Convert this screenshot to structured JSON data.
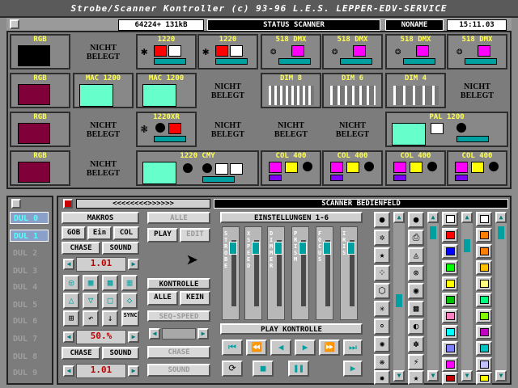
{
  "title": "Strobe/Scanner Kontroller (c) 93-96 L.E.S. LEPPER-EDV-SERVICE",
  "status": {
    "memory": "64224+ 131kB",
    "header": "STATUS SCANNER",
    "file": "NONAME",
    "time": "15:11.03"
  },
  "grid": {
    "row1": [
      "RGB",
      "NICHT BELEGT",
      "1220",
      "1220",
      "518 DMX",
      "518 DMX",
      "518 DMX",
      "518 DMX"
    ],
    "row2": [
      "RGB",
      "MAC 1200",
      "MAC 1200",
      "NICHT BELEGT",
      "DIM 8",
      "DIM 6",
      "DIM 4",
      "NICHT BELEGT"
    ],
    "row3": [
      "RGB",
      "NICHT BELEGT",
      "1220XR",
      "NICHT BELEGT",
      "NICHT BELEGT",
      "NICHT BELEGT",
      "PAL 1200",
      ""
    ],
    "row4": [
      "RGB",
      "NICHT BELEGT",
      "1220 CMY",
      "COL 400",
      "COL 400",
      "COL 400",
      "COL 400"
    ]
  },
  "dul": [
    "DUL 0",
    "DUL 1",
    "DUL 2",
    "DUL 3",
    "DUL 4",
    "DUL 5",
    "DUL 6",
    "DUL 7",
    "DUL 8",
    "DUL 9"
  ],
  "panel": {
    "title": "SCANNER BEDIENFELD",
    "arrows": "<<<<<<<<>>>>>>",
    "makros": "MAKROS",
    "gob": "GOB",
    "ein": "Ein",
    "col": "COL",
    "chase": "CHASE",
    "sound": "SOUND",
    "val1": "1.01",
    "val2": "50.%",
    "val3": "1.01",
    "chase2": "CHASE",
    "sound2": "SOUND",
    "alle": "ALLE",
    "play": "PLAY",
    "edit": "EDIT",
    "kontrolle": "KONTROLLE",
    "alle2": "ALLE",
    "kein": "KEIN",
    "seqspeed": "SEQ-SPEED",
    "chase3": "CHASE",
    "sound3": "SOUND",
    "einst": "EINSTELLUNGEN 1-6",
    "channels": [
      "STROBE",
      "X SPEED",
      "DIMMER",
      "PRISM",
      "FOCUS",
      "IRIS"
    ],
    "playk": "PLAY KONTROLLE",
    "sync": "SYNC"
  },
  "colors": {
    "accent": "#00a0a0",
    "swatches": [
      "#ffffff",
      "#ff0000",
      "#0000ff",
      "#00ff00",
      "#ffff00",
      "#ff00ff",
      "#00ffff",
      "#ff8000"
    ]
  }
}
